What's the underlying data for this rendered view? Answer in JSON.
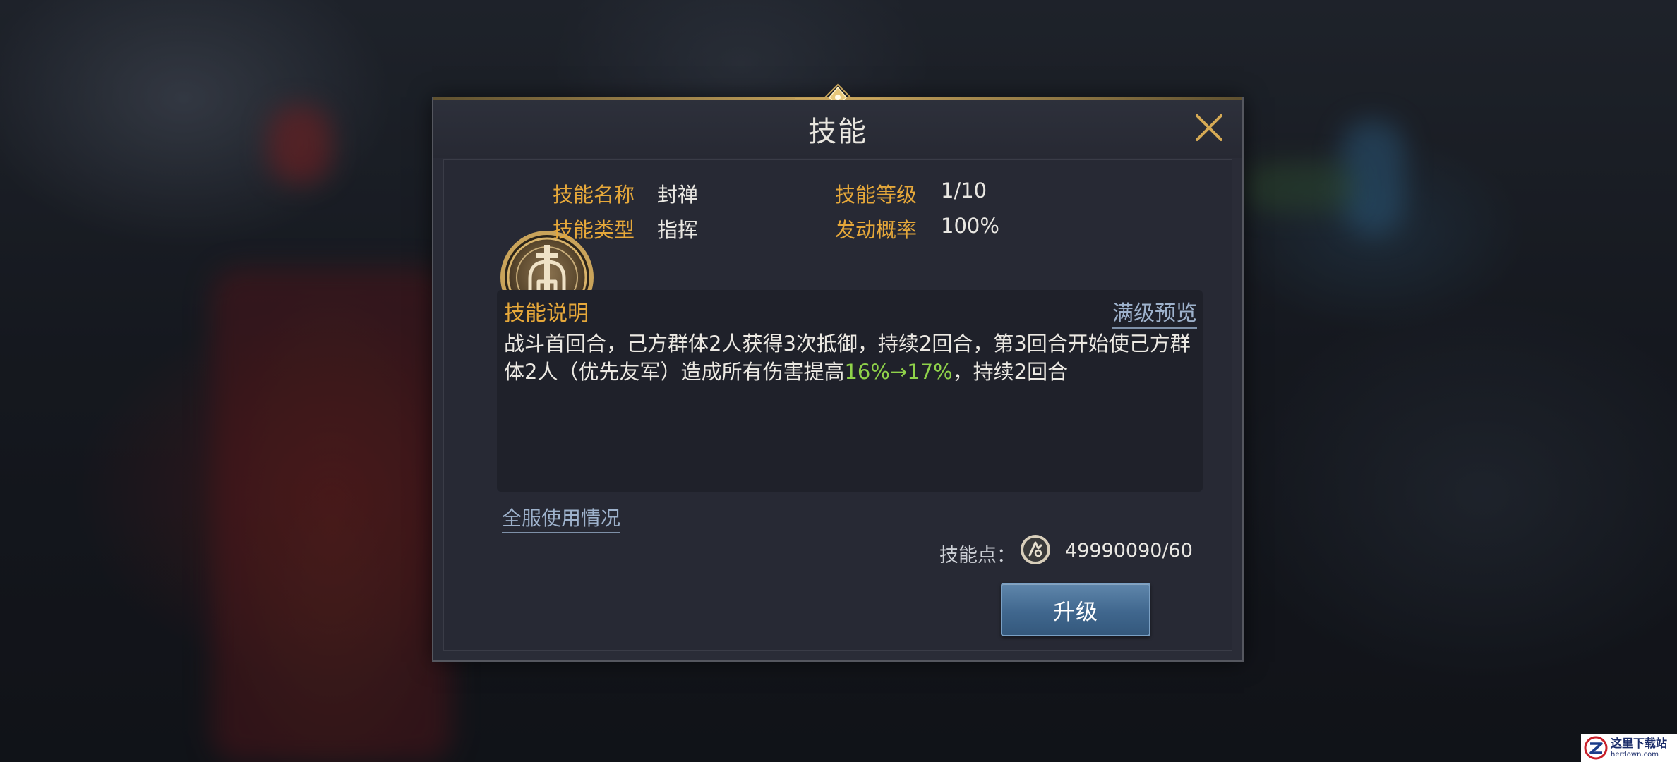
{
  "dialog": {
    "title": "技能",
    "close_icon": "close-icon"
  },
  "skill": {
    "icon": "helmet-sword-icon",
    "name_label": "技能名称",
    "name_value": "封禅",
    "type_label": "技能类型",
    "type_value": "指挥",
    "level_label": "技能等级",
    "level_value": "1/10",
    "chance_label": "发动概率",
    "chance_value": "100%"
  },
  "description": {
    "title": "技能说明",
    "preview_link": "满级预览",
    "text_before": "战斗首回合，己方群体2人获得3次抵御，持续2回合，第3回合开始使己方群体2人（优先友军）造成所有伤害提高",
    "highlight": "16%→17%",
    "text_after": "，持续2回合",
    "highlight_color": "#8fd24a"
  },
  "usage_link": "全服使用情况",
  "points": {
    "label": "技能点：",
    "icon": "skill-point-coin-icon",
    "value": "49990090/60"
  },
  "upgrade_button": "升级",
  "watermark": {
    "cn": "这里下载站",
    "en": "herdown.com"
  },
  "colors": {
    "label_gold": "#e6a83a",
    "link_blue": "#9eb2cc",
    "button_blue": "#40678e"
  }
}
